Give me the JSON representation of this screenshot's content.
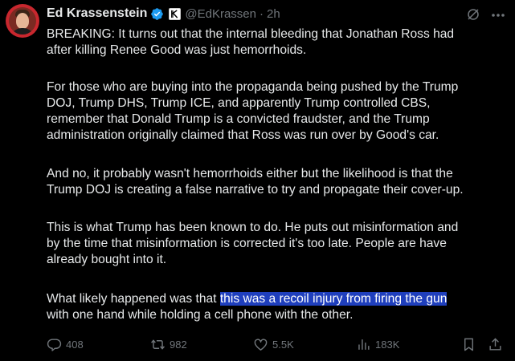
{
  "author": {
    "name": "Ed Krassenstein",
    "handle": "@EdKrassen",
    "time": "2h",
    "separator": "·"
  },
  "icons": {
    "verified": "verified-badge-icon",
    "affiliate": "affiliate-k-icon",
    "grok": "grok-icon",
    "more": "more-icon",
    "reply": "reply-icon",
    "repost": "repost-icon",
    "like": "like-icon",
    "views": "views-icon",
    "bookmark": "bookmark-icon",
    "share": "share-icon"
  },
  "post": {
    "p1_line1": "BREAKING: It turns out that the internal bleeding that Jonathan Ross had",
    "p1_line2": "after killing Renee Good was just hemorrhoids.",
    "p2_line1": "For those who are buying into the propaganda being pushed by the Trump",
    "p2_line2": "DOJ, Trump DHS, Trump ICE, and apparently Trump controlled CBS,",
    "p2_line3": "remember that Donald Trump is a convicted fraudster, and the Trump",
    "p2_line4": "administration originally claimed that Ross was run over by Good's car.",
    "p3_line1": "And no, it probably wasn't hemorrhoids either but the likelihood is that the",
    "p3_line2": "Trump DOJ is creating a false narrative to try and propagate their cover-up.",
    "p4_line1": "This is what Trump has been known to do. He puts out misinformation and",
    "p4_line2": "by the time that misinformation is corrected it's too late. People are have",
    "p4_line3": "already bought into it.",
    "p5_prefix": "What likely happened was that ",
    "p5_highlight": "this was a recoil injury from firing the gun",
    "p5_line2": "with one hand while holding a cell phone with the other."
  },
  "metrics": {
    "replies": "408",
    "reposts": "982",
    "likes": "5.5K",
    "views": "183K"
  },
  "colors": {
    "background": "#000000",
    "text": "#e7e9ea",
    "muted": "#71767b",
    "verified": "#1d9bf0",
    "highlight": "#1f3fbd"
  }
}
